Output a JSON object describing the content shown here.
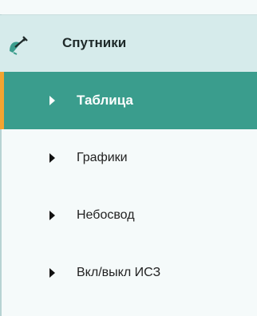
{
  "menu": {
    "section": {
      "title": "Спутники",
      "icon": "satellite-dish-icon"
    },
    "items": [
      {
        "label": "Таблица",
        "active": true,
        "icon": "caret-right-icon"
      },
      {
        "label": "Графики",
        "active": false,
        "icon": "caret-right-icon"
      },
      {
        "label": "Небосвод",
        "active": false,
        "icon": "caret-right-icon"
      },
      {
        "label": "Вкл/выкл ИСЗ",
        "active": false,
        "icon": "caret-right-icon"
      }
    ]
  },
  "colors": {
    "header_bg": "#d6ebeb",
    "active_bg": "#3a9d8d",
    "active_marker": "#f3a431",
    "panel_bg": "#f5fafa"
  }
}
